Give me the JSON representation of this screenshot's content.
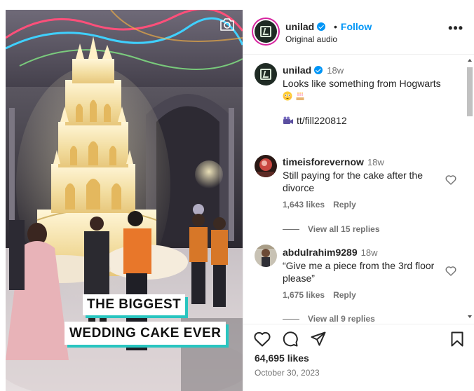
{
  "media": {
    "caption_line1": "THE BIGGEST",
    "caption_line2": "WEDDING CAKE EVER",
    "camera_icon": "camera-icon"
  },
  "header": {
    "username": "unilad",
    "verified": true,
    "separator": "•",
    "follow_label": "Follow",
    "subtitle": "Original audio",
    "more_icon": "more-options-icon",
    "more_glyph": "•••"
  },
  "caption": {
    "username": "unilad",
    "time": "18w",
    "text": "Looks like something from Hogwarts",
    "emojis": [
      "flushed-face-emoji",
      "birthday-cake-emoji"
    ],
    "link": "tt/fill220812",
    "link_icon": "movie-camera-emoji"
  },
  "comments": [
    {
      "username": "timeisforevernow",
      "time": "18w",
      "text": "Still paying for the cake after the divorce",
      "likes": "1,643 likes",
      "reply_label": "Reply",
      "view_replies": "View all 15 replies"
    },
    {
      "username": "abdulrahim9289",
      "time": "18w",
      "text": "“Give me a piece from the 3rd floor please”",
      "likes": "1,675 likes",
      "reply_label": "Reply",
      "view_replies": "View all 9 replies"
    }
  ],
  "actions": {
    "icons": [
      "heart-icon",
      "comment-icon",
      "share-icon",
      "bookmark-icon"
    ],
    "likes": "64,695 likes",
    "date": "October 30, 2023"
  },
  "colors": {
    "accent": "#0095f6",
    "caption_shadow": "#29c5c0",
    "muted": "#737373",
    "story_ring": "#d6249f"
  }
}
